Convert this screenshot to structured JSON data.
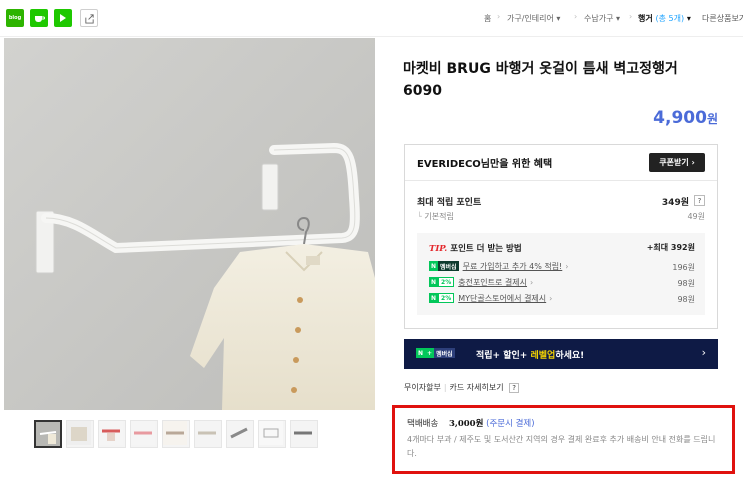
{
  "share": {
    "blog_text": "blog"
  },
  "breadcrumb": {
    "home": "홈",
    "level1": "가구/인테리어",
    "level2": "수납가구",
    "current": "행거",
    "current_count": "(총 5개)",
    "more": "다른상품보기"
  },
  "product": {
    "title": "마켓비 BRUG 바행거 옷걸이 틈새 벽고정행거 6090",
    "price": "4,900",
    "price_unit": "원"
  },
  "benefit": {
    "title": "EVERIDECO님만을 위한 혜택",
    "coupon_button": "쿠폰받기 ›",
    "max_points_label": "최대 적립 포인트",
    "max_points_value": "349원",
    "base_label": "기본적립",
    "base_value": "49원",
    "tip_prefix": "TIP.",
    "tip_title": "포인트 더 받는 방법",
    "tip_max": "+최대 392원",
    "rows": [
      {
        "badge_n": "N",
        "badge_tag": "멤버십",
        "text": "무료 가입하고 추가 4% 적립!",
        "value": "196원"
      },
      {
        "badge_n": "N",
        "badge_tag": "2%",
        "text": "충전포인트로 결제시",
        "value": "98원"
      },
      {
        "badge_n": "N",
        "badge_tag": "2%",
        "text": "MY단골스토어에서 결제시",
        "value": "98원"
      }
    ]
  },
  "membership": {
    "badge_tag": "멤버십",
    "text_a": "적립+ 할인+ ",
    "text_hl": "레벨업",
    "text_b": "하세요!",
    "arrow": "›"
  },
  "installment": {
    "interest_free": "무이자할부",
    "card_detail": "카드 자세히보기",
    "help": "?"
  },
  "shipping": {
    "label": "택배배송",
    "fee": "3,000원",
    "payment": "(주문시 결제)",
    "description": "4개마다 부과 / 제주도 및 도서산간 지역의 경우 결제 완료후 추가 배송비 안내 전화를 드립니다."
  },
  "thumbnails": {
    "count_visible": 9,
    "active_index": 0
  },
  "colors": {
    "price_blue": "#4b6bd8",
    "naver_green": "#03c75a",
    "highlight_red": "#e0120e",
    "membership_navy": "#0e1a45"
  }
}
